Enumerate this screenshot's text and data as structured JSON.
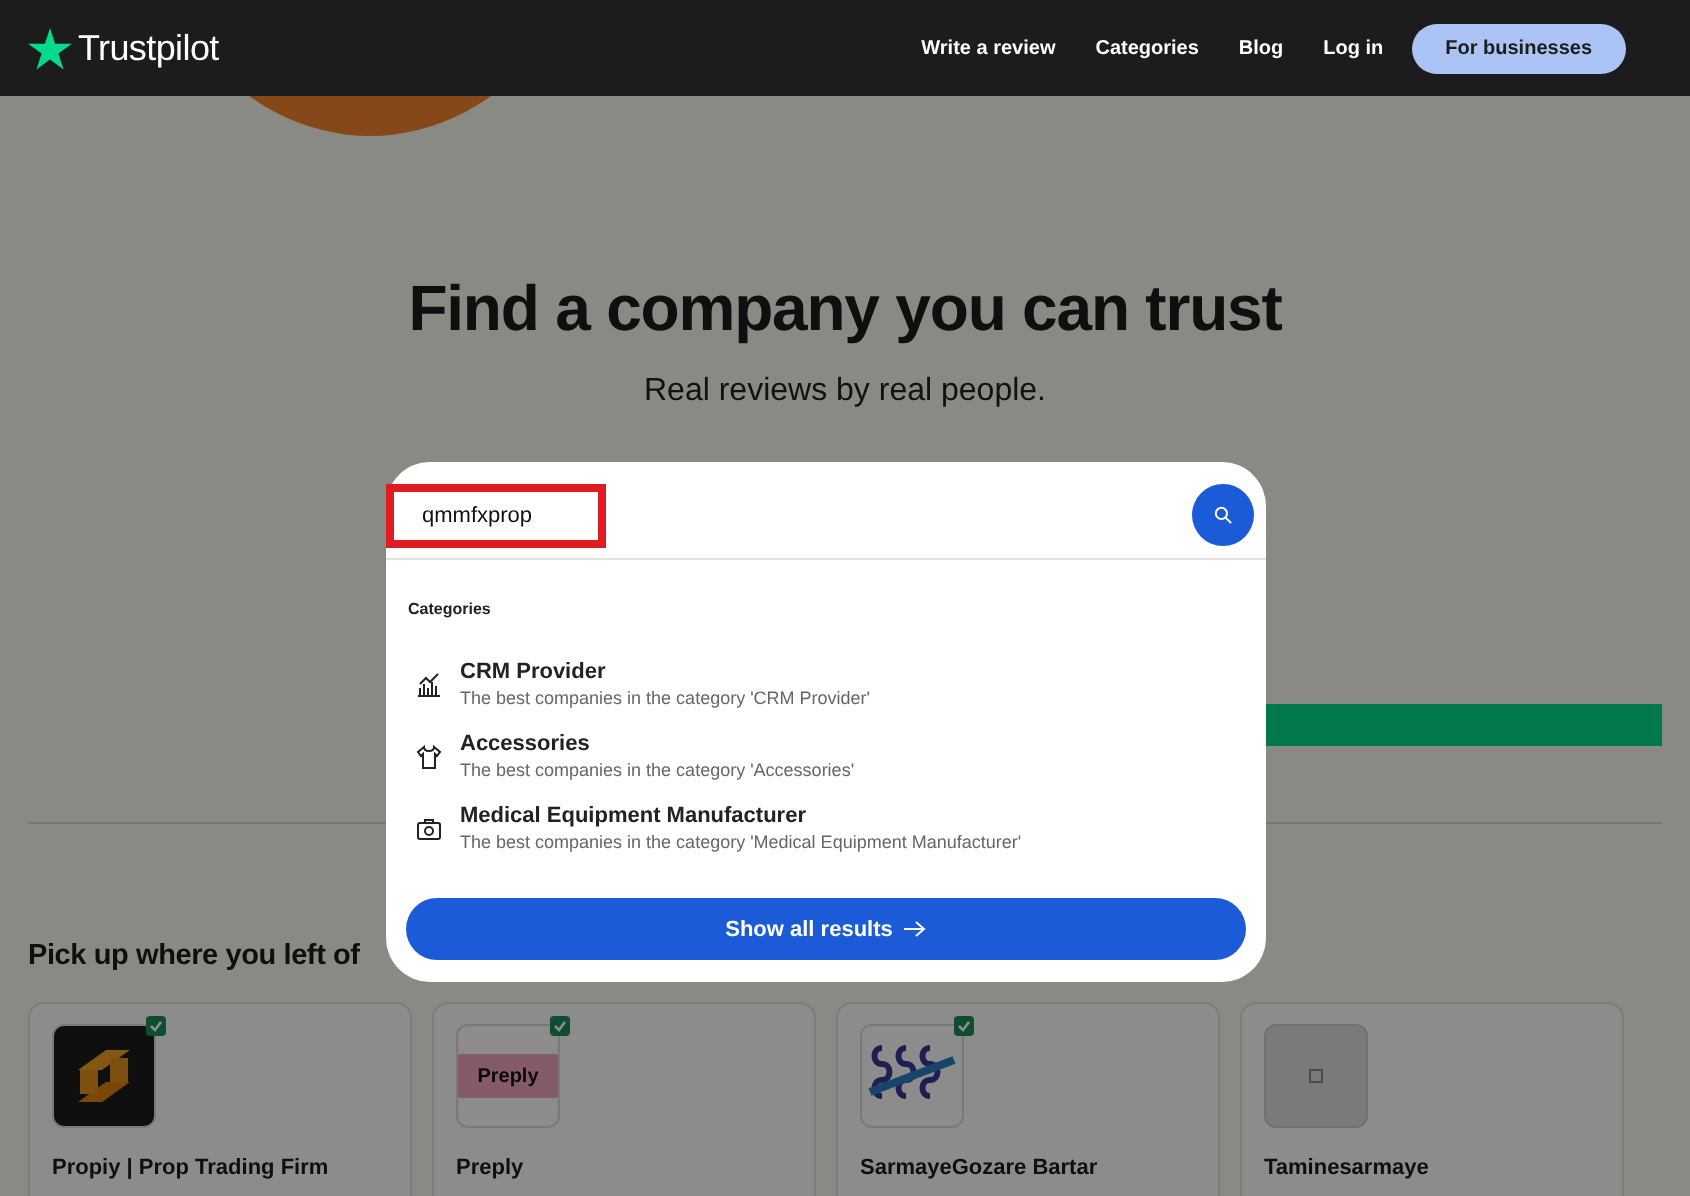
{
  "header": {
    "logo_text": "Trustpilot",
    "nav": [
      "Write a review",
      "Categories",
      "Blog",
      "Log in"
    ],
    "cta": "For businesses"
  },
  "hero": {
    "title": "Find a company you can trust",
    "subtitle": "Real reviews by real people."
  },
  "search": {
    "value": "qmmfxprop",
    "section_label": "Categories",
    "suggestions": [
      {
        "title": "CRM Provider",
        "description": "The best companies in the category 'CRM Provider'"
      },
      {
        "title": "Accessories",
        "description": "The best companies in the category 'Accessories'"
      },
      {
        "title": "Medical Equipment Manufacturer",
        "description": "The best companies in the category 'Medical Equipment Manufacturer'"
      }
    ],
    "show_all": "Show all results"
  },
  "recent": {
    "heading": "Pick up where you left of",
    "companies": [
      {
        "name": "Propiy | Prop Trading Firm",
        "verified": true
      },
      {
        "name": "Preply",
        "verified": true,
        "logo_text": "Preply"
      },
      {
        "name": "SarmayeGozare Bartar",
        "verified": true
      },
      {
        "name": "Taminesarmaye",
        "verified": false
      }
    ]
  }
}
